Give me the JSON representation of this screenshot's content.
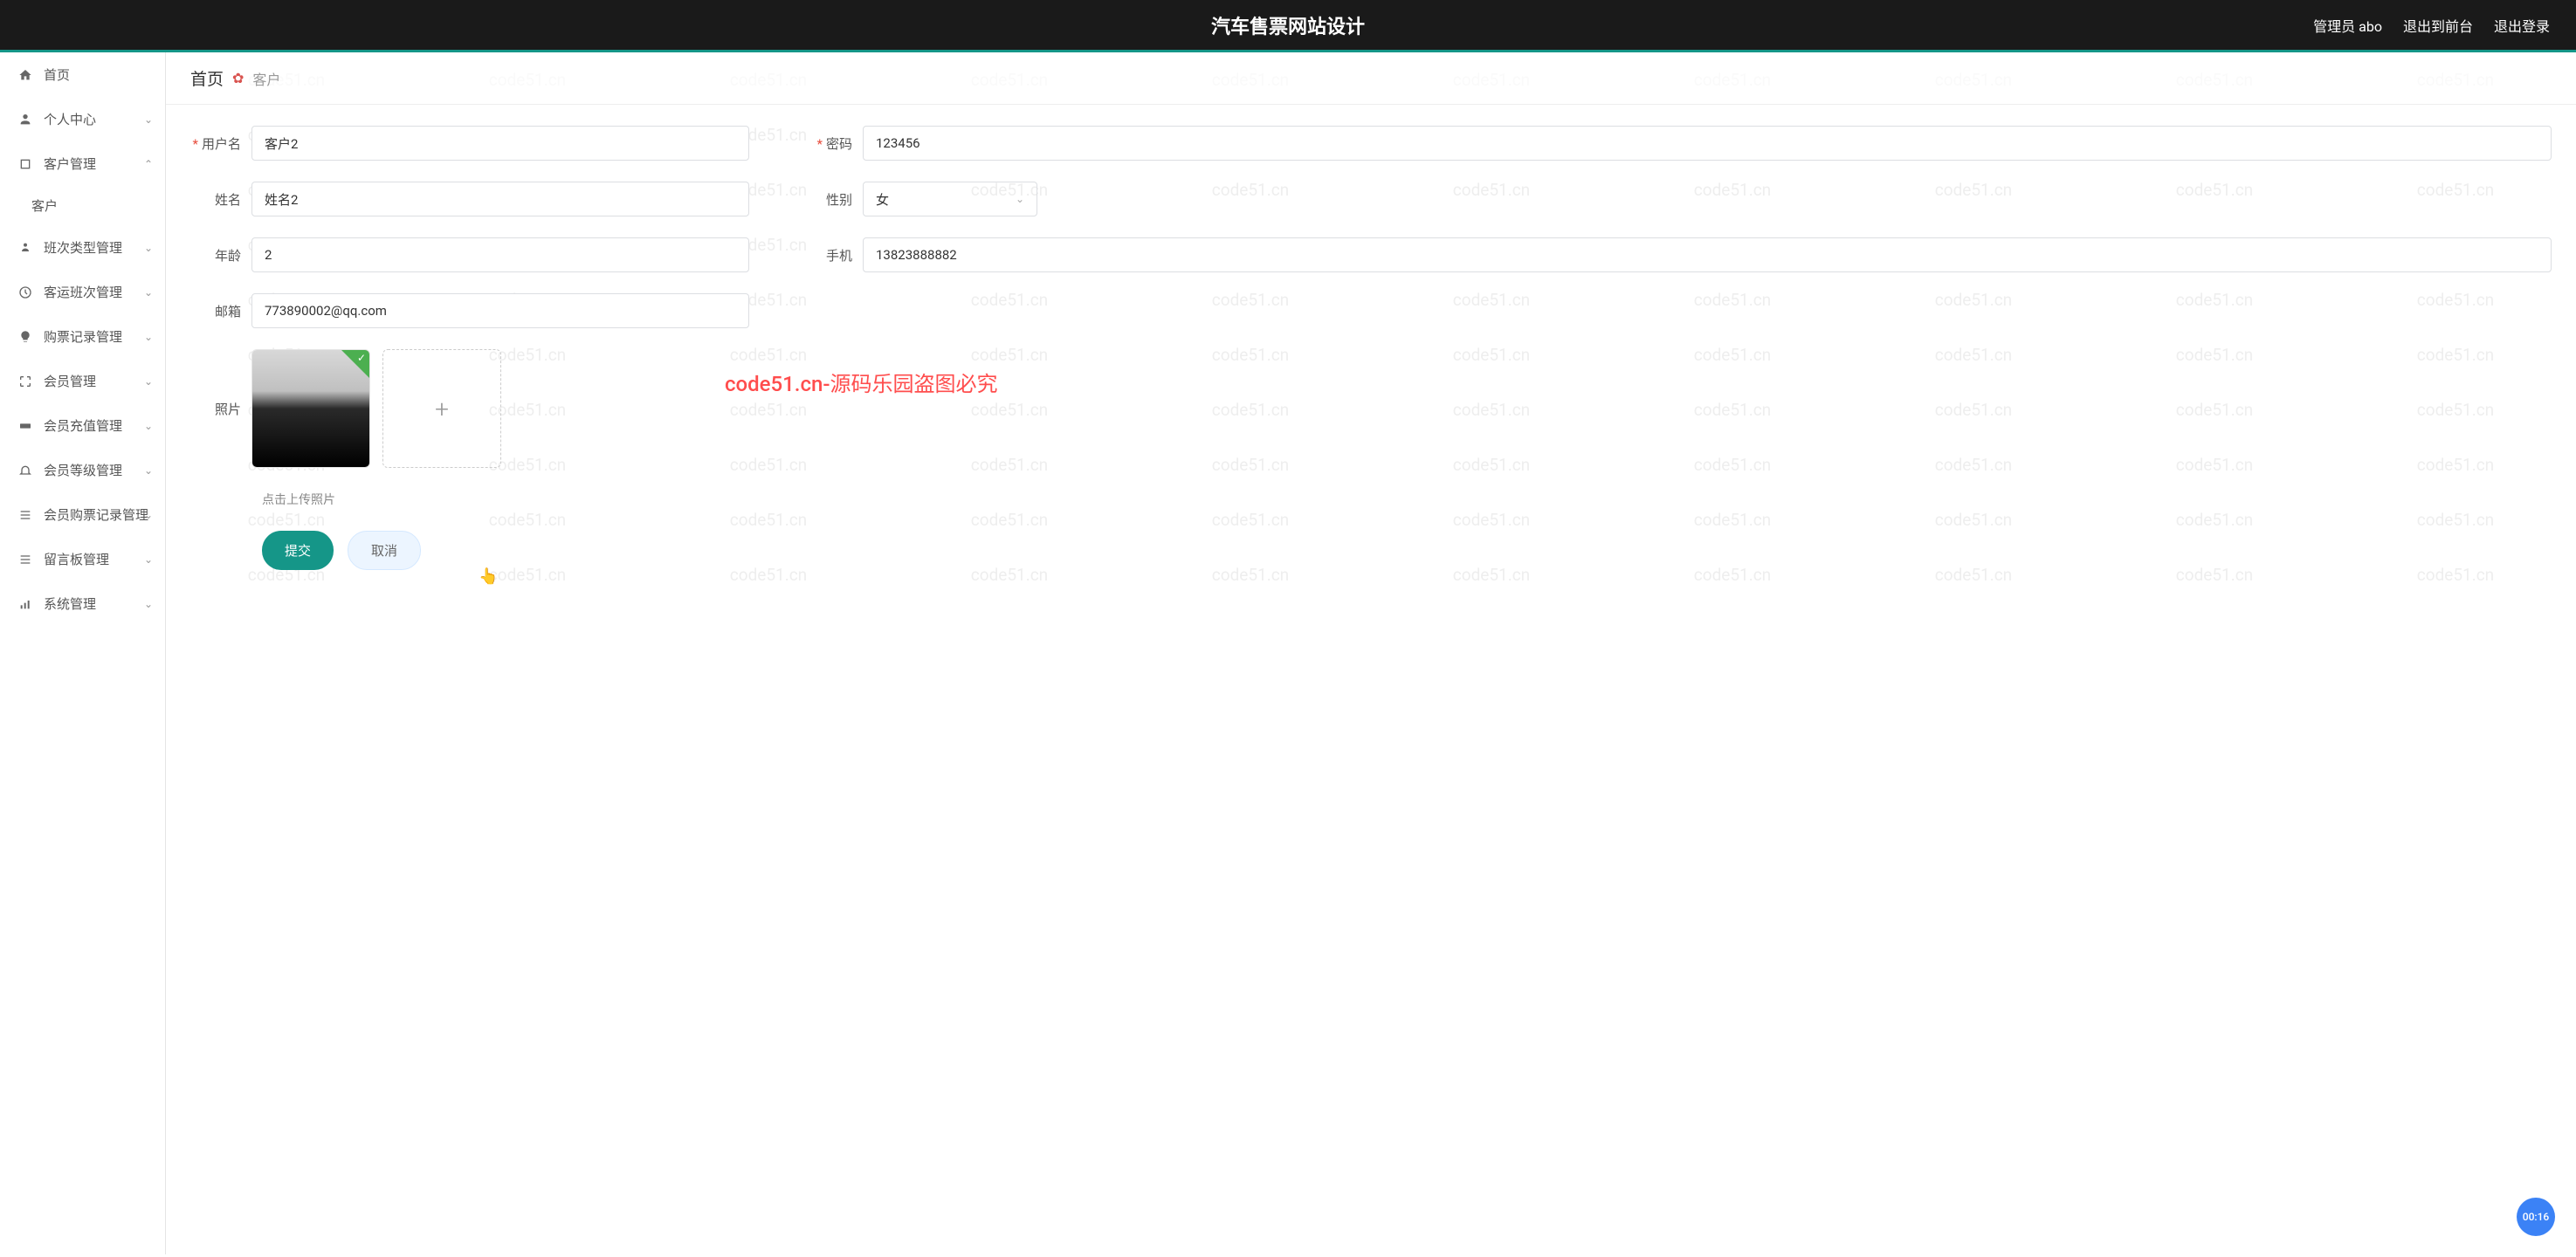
{
  "header": {
    "title": "汽车售票网站设计",
    "admin": "管理员 abo",
    "exitFront": "退出到前台",
    "logout": "退出登录"
  },
  "sidebar": {
    "items": [
      {
        "label": "首页",
        "icon": "home",
        "expandable": false
      },
      {
        "label": "个人中心",
        "icon": "person",
        "expandable": true
      },
      {
        "label": "客户管理",
        "icon": "crop",
        "expandable": true,
        "sub": [
          "客户"
        ]
      },
      {
        "label": "班次类型管理",
        "icon": "person-dots",
        "expandable": true
      },
      {
        "label": "客运班次管理",
        "icon": "clock",
        "expandable": true
      },
      {
        "label": "购票记录管理",
        "icon": "bulb",
        "expandable": true
      },
      {
        "label": "会员管理",
        "icon": "fullscreen",
        "expandable": true
      },
      {
        "label": "会员充值管理",
        "icon": "ticket",
        "expandable": true
      },
      {
        "label": "会员等级管理",
        "icon": "bell",
        "expandable": true
      },
      {
        "label": "会员购票记录管理",
        "icon": "menu",
        "expandable": true
      },
      {
        "label": "留言板管理",
        "icon": "menu",
        "expandable": true
      },
      {
        "label": "系统管理",
        "icon": "bars",
        "expandable": true
      }
    ]
  },
  "breadcrumb": {
    "home": "首页",
    "current": "客户"
  },
  "form": {
    "fields": {
      "username": {
        "label": "用户名",
        "value": "客户2",
        "required": true
      },
      "password": {
        "label": "密码",
        "value": "123456",
        "required": true
      },
      "name": {
        "label": "姓名",
        "value": "姓名2",
        "required": false
      },
      "gender": {
        "label": "性别",
        "value": "女",
        "required": false
      },
      "age": {
        "label": "年龄",
        "value": "2",
        "required": false
      },
      "phone": {
        "label": "手机",
        "value": "13823888882",
        "required": false
      },
      "email": {
        "label": "邮箱",
        "value": "773890002@qq.com",
        "required": false
      },
      "photo": {
        "label": "照片"
      }
    },
    "uploadHint": "点击上传照片",
    "submit": "提交",
    "cancel": "取消"
  },
  "watermark": "code51.cn",
  "watermarkNotice": "code51.cn-源码乐园盗图必究",
  "timer": "00:16"
}
